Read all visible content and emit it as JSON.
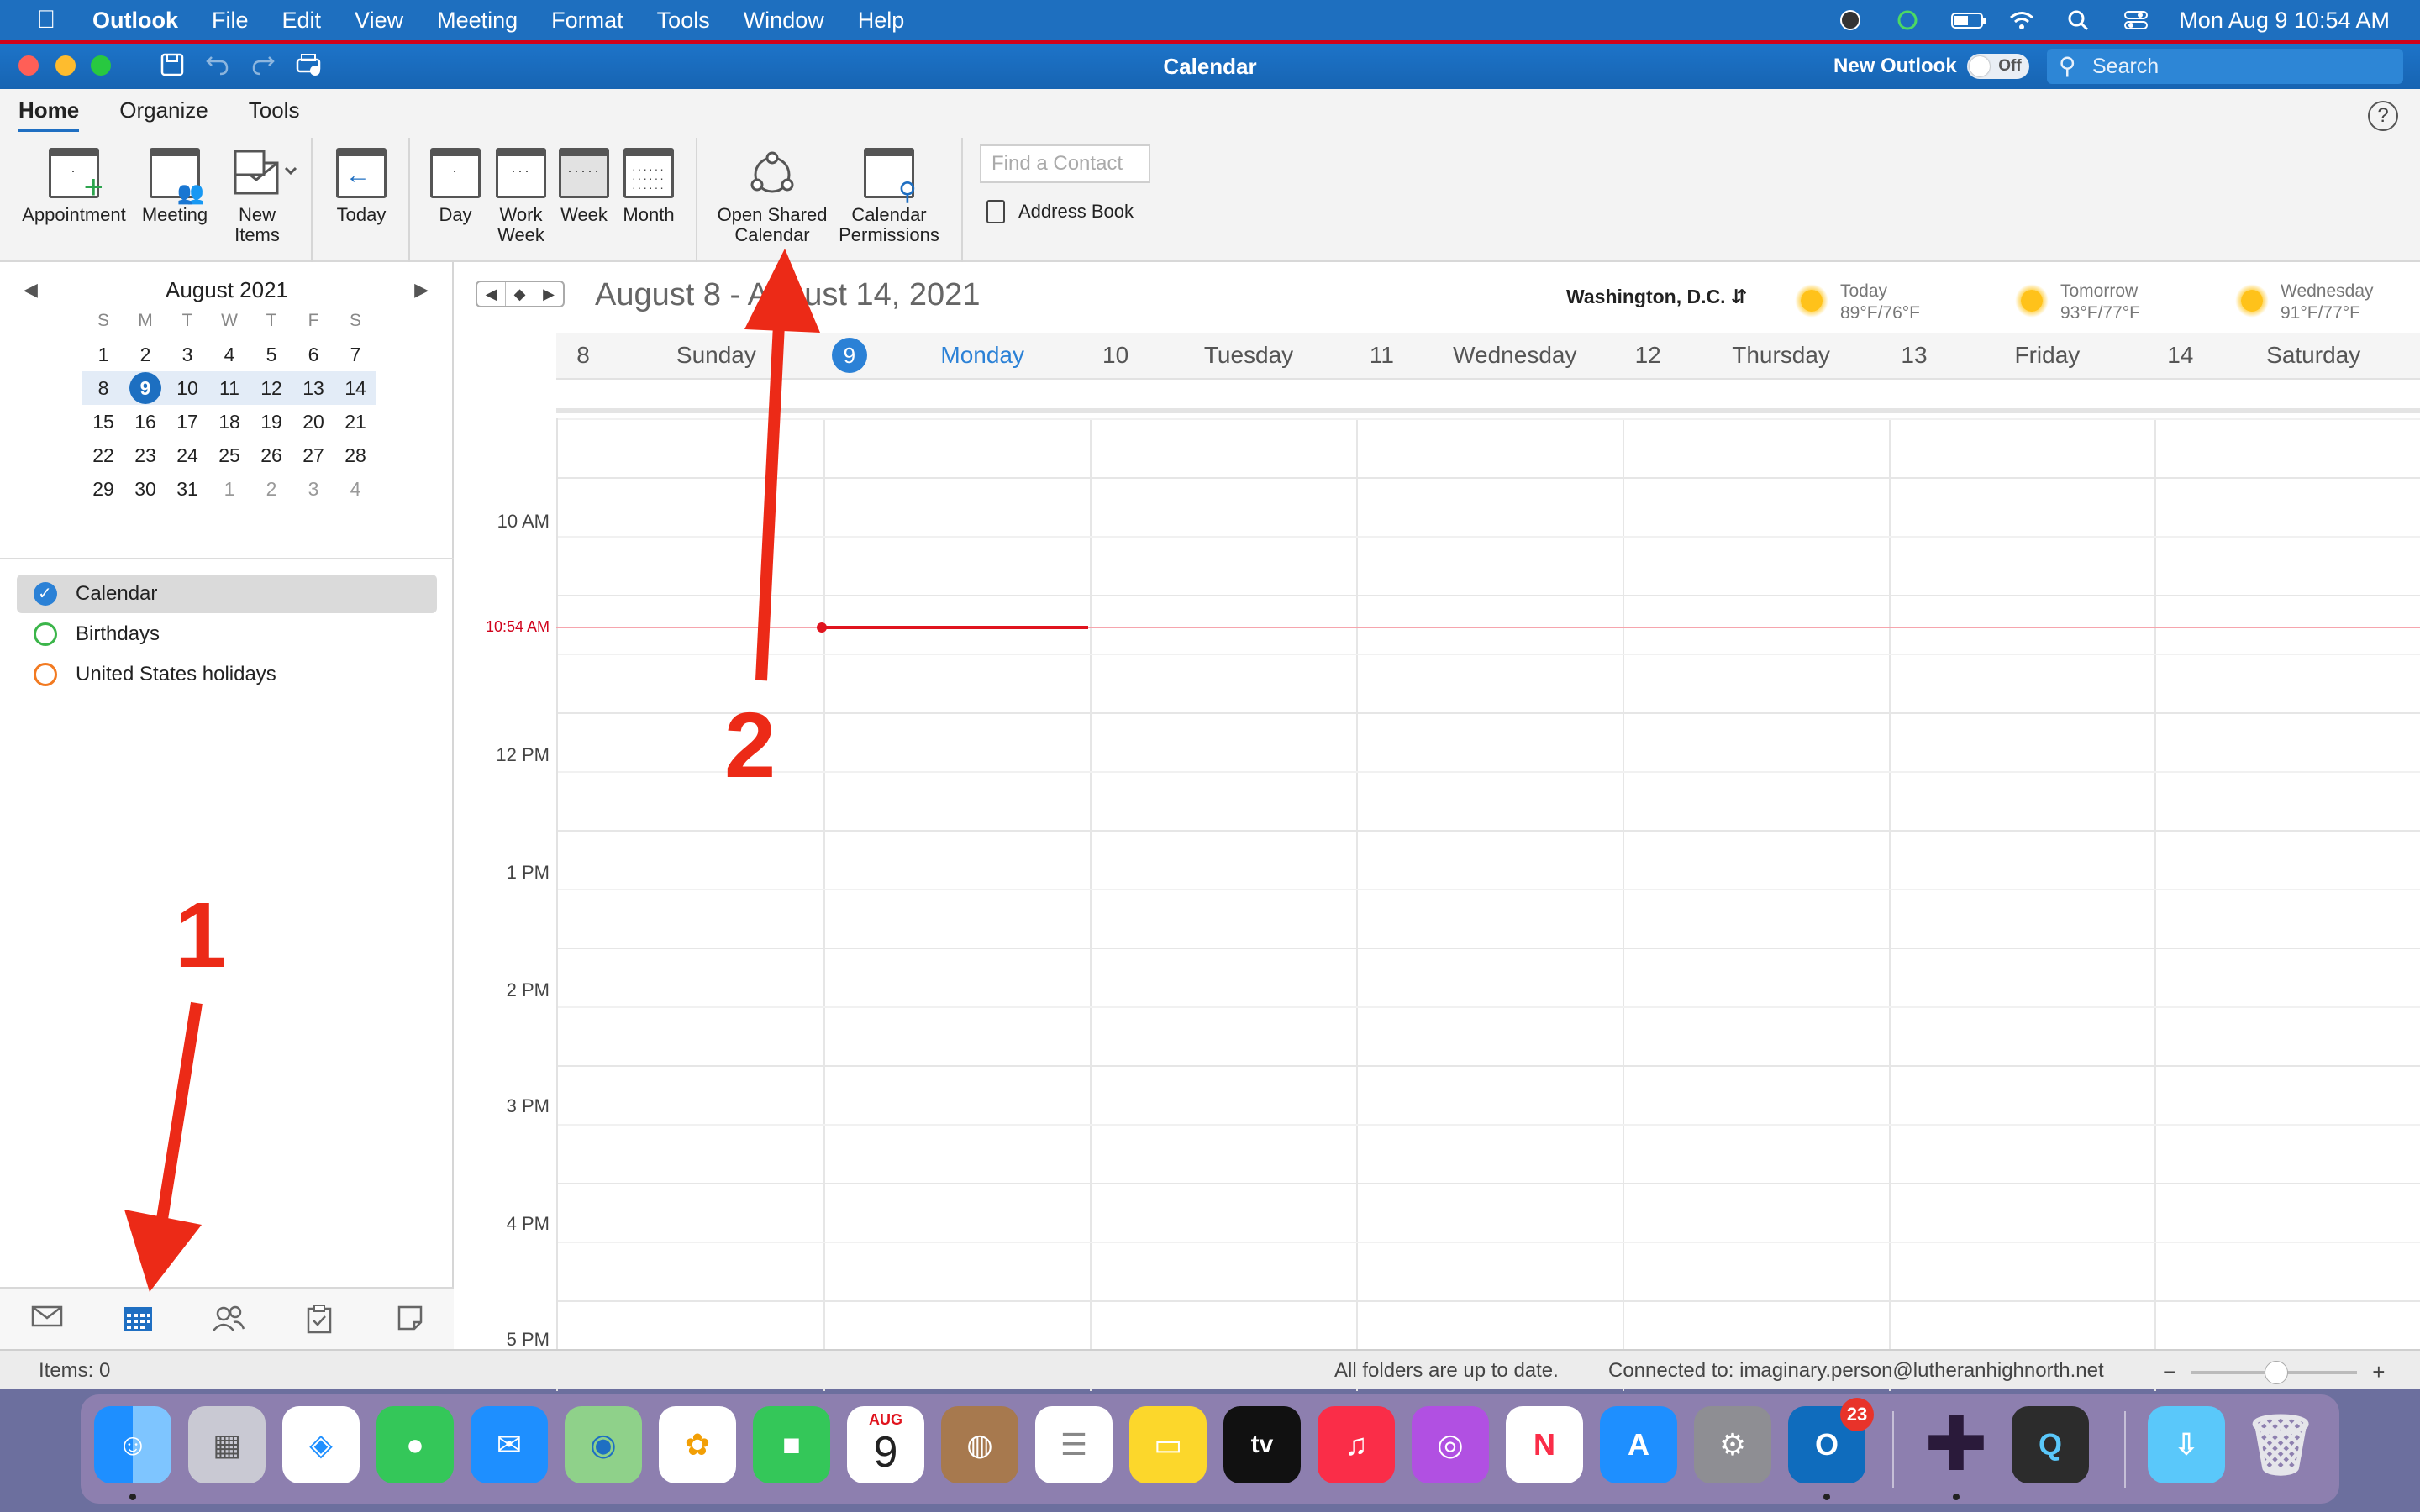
{
  "menubar": {
    "apple": "",
    "app": "Outlook",
    "items": [
      "File",
      "Edit",
      "View",
      "Meeting",
      "Format",
      "Tools",
      "Window",
      "Help"
    ],
    "datetime": "Mon Aug 9  10:54 AM"
  },
  "titlebar": {
    "title": "Calendar",
    "new_outlook_label": "New Outlook",
    "toggle_label": "Off",
    "search_placeholder": "Search"
  },
  "ribbon": {
    "tabs": [
      "Home",
      "Organize",
      "Tools"
    ],
    "active_tab": "Home",
    "help": "?",
    "buttons": {
      "appointment": "Appointment",
      "meeting": "Meeting",
      "new_items_line1": "New",
      "new_items_line2": "Items",
      "today": "Today",
      "day": "Day",
      "work_week_line1": "Work",
      "work_week_line2": "Week",
      "week": "Week",
      "month": "Month",
      "open_shared_line1": "Open Shared",
      "open_shared_line2": "Calendar",
      "cal_perm_line1": "Calendar",
      "cal_perm_line2": "Permissions"
    },
    "find_contact_placeholder": "Find a Contact",
    "address_book": "Address Book"
  },
  "mini_calendar": {
    "month_label": "August 2021",
    "dow": [
      "S",
      "M",
      "T",
      "W",
      "T",
      "F",
      "S"
    ],
    "weeks": [
      [
        "1",
        "2",
        "3",
        "4",
        "5",
        "6",
        "7"
      ],
      [
        "8",
        "9",
        "10",
        "11",
        "12",
        "13",
        "14"
      ],
      [
        "15",
        "16",
        "17",
        "18",
        "19",
        "20",
        "21"
      ],
      [
        "22",
        "23",
        "24",
        "25",
        "26",
        "27",
        "28"
      ],
      [
        "29",
        "30",
        "31",
        "1",
        "2",
        "3",
        "4"
      ]
    ],
    "today": "9"
  },
  "calendars": [
    {
      "name": "Calendar",
      "color": "#2b81d6",
      "checked": true
    },
    {
      "name": "Birthdays",
      "color": "#3bb54a",
      "checked": false
    },
    {
      "name": "United States holidays",
      "color": "#f27a21",
      "checked": false
    }
  ],
  "main": {
    "range": "August 8 - August 14, 2021",
    "location": "Washington, D.C.",
    "weather": [
      {
        "label": "Today",
        "temps": "89°F/76°F"
      },
      {
        "label": "Tomorrow",
        "temps": "93°F/77°F"
      },
      {
        "label": "Wednesday",
        "temps": "91°F/77°F"
      }
    ],
    "days": [
      {
        "num": "8",
        "name": "Sunday"
      },
      {
        "num": "9",
        "name": "Monday"
      },
      {
        "num": "10",
        "name": "Tuesday"
      },
      {
        "num": "11",
        "name": "Wednesday"
      },
      {
        "num": "12",
        "name": "Thursday"
      },
      {
        "num": "13",
        "name": "Friday"
      },
      {
        "num": "14",
        "name": "Saturday"
      }
    ],
    "times": [
      "10 AM",
      "12 PM",
      "1 PM",
      "2 PM",
      "3 PM",
      "4 PM",
      "5 PM"
    ],
    "now_label": "10:54 AM"
  },
  "statusbar": {
    "items": "Items: 0",
    "sync": "All folders are up to date.",
    "connected": "Connected to: imaginary.person@lutheranhighnorth.net",
    "zoom_minus": "−",
    "zoom_plus": "+"
  },
  "dock": {
    "calendar_month": "AUG",
    "calendar_day": "9",
    "outlook_badge": "23",
    "tv_label": "tv"
  },
  "annotations": {
    "label_1": "1",
    "label_2": "2"
  },
  "colors": {
    "accent": "#1f6fc2",
    "annotation": "#ec2a17",
    "now_line": "#e0141e"
  }
}
